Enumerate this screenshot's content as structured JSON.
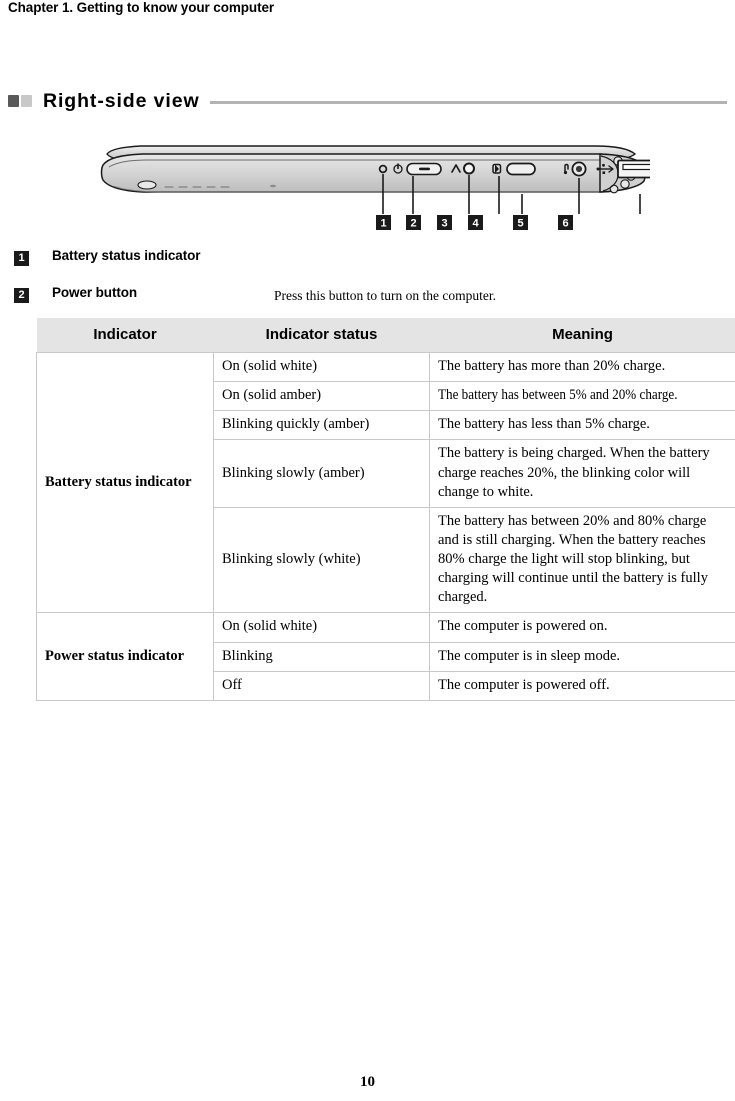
{
  "running_head": "Chapter 1. Getting to know your computer",
  "section": {
    "title": "Right-side view",
    "bullet_dark_color": "#595959",
    "bullet_light_color": "#c8c8c8",
    "rule_color": "#b3b3b3"
  },
  "figure": {
    "alt": "Right-side view of the computer chassis",
    "callouts": [
      {
        "number": "1",
        "icon": "battery-status-indicator-icon"
      },
      {
        "number": "2",
        "icon": "power-button-icon"
      },
      {
        "number": "3",
        "icon": "novo-button-icon"
      },
      {
        "number": "4",
        "icon": "volume-button-icon"
      },
      {
        "number": "5",
        "icon": "headphone-jack-icon"
      },
      {
        "number": "6",
        "icon": "usb-3-port-icon"
      }
    ],
    "port_label": "SS"
  },
  "items": [
    {
      "number": "1",
      "label": "Battery status indicator",
      "description": ""
    },
    {
      "number": "2",
      "label": "Power button",
      "description": "Press this button to turn on the computer."
    }
  ],
  "table": {
    "headers": [
      "Indicator",
      "Indicator status",
      "Meaning"
    ],
    "groups": [
      {
        "name": "Battery status indicator",
        "rows": [
          {
            "status": "On (solid white)",
            "meaning": "The battery has more than 20% charge.",
            "condensed": false
          },
          {
            "status": "On (solid amber)",
            "meaning": "The battery has between 5% and 20% charge.",
            "condensed": true
          },
          {
            "status": "Blinking quickly (amber)",
            "meaning": "The battery has less than 5% charge.",
            "condensed": false
          },
          {
            "status": "Blinking slowly (amber)",
            "meaning": "The battery is being charged. When the battery charge reaches 20%, the blinking color will change to white.",
            "condensed": false
          },
          {
            "status": "Blinking slowly (white)",
            "meaning": "The battery has between 20% and 80% charge and is still charging. When the battery reaches 80% charge the light will stop blinking, but charging will continue until the battery is fully charged.",
            "condensed": false
          }
        ]
      },
      {
        "name": "Power status indicator",
        "rows": [
          {
            "status": "On (solid white)",
            "meaning": "The computer is powered on.",
            "condensed": false
          },
          {
            "status": "Blinking",
            "meaning": "The computer is in sleep mode.",
            "condensed": false
          },
          {
            "status": "Off",
            "meaning": "The computer is powered off.",
            "condensed": false
          }
        ]
      }
    ]
  },
  "page_number": "10"
}
